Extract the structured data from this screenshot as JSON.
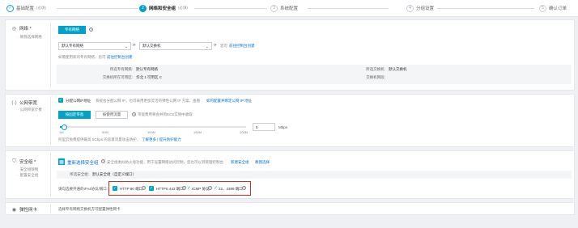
{
  "steps": [
    {
      "num": "✓",
      "label": "基础配置",
      "sub": "(必填)",
      "state": "done"
    },
    {
      "num": "2",
      "label": "网络和安全组",
      "sub": "(必填)",
      "state": "active"
    },
    {
      "num": "3",
      "label": "系统配置",
      "sub": "",
      "state": "todo"
    },
    {
      "num": "4",
      "label": "分组设置",
      "sub": "",
      "state": "todo"
    },
    {
      "num": "5",
      "label": "确认订单",
      "sub": "",
      "state": "todo"
    }
  ],
  "network": {
    "title": "网络 *",
    "subtitle": "· 教我选择网络",
    "tab_label": "专有网络",
    "vpc_select": "默认专有网络",
    "vswitch_select": "默认交换机",
    "refresh_hint": "您可",
    "vswitch_link": "前往控制台创建",
    "note_text": "如需使用新的专有网络，您可",
    "note_link": "前往控制台创建",
    "info": [
      {
        "key": "所选专有网络:",
        "val": "默认专有网络"
      },
      {
        "key": "交换机所在可用区:",
        "val": "华北 1 可用区 C"
      },
      {
        "key": "所选交换机:",
        "val": "默认交换机"
      },
      {
        "key": "交换机网段:",
        "val": ""
      }
    ]
  },
  "public_ip": {
    "title": "公网带宽",
    "subtitle": "· 公网带宽计费",
    "checkbox_label": "分配公网IP地址",
    "checkbox_hint": "系统会分配公网 IP，也可采用更加灵活的弹性公网 IP 方案，查看",
    "checkbox_link": "如何配置并绑定公网 IP 地址",
    "billing_options": [
      "按固定带宽",
      "按使用流量"
    ],
    "billing_hint": "带宽费用将会并到ECS实例中收取",
    "ticks": [
      "1M",
      "50M",
      "100M",
      "150M",
      "200M"
    ],
    "bandwidth_value": "5",
    "bandwidth_fraction": 0.02,
    "unit": "Mbps",
    "footnote": "阿里云免费提供最高 5Gbps 的恶意流量攻击防护，",
    "footnote_link": "了解更多 | 提升防护能力"
  },
  "security": {
    "title": "安全组 *",
    "subtitle1": "· 安全组限制",
    "subtitle2": "· 配置安全组",
    "reselect_label": "重新选择安全组",
    "reselect_hint": "安全组类似防火墙功能，用于设置网络访问控制，您也可以到管理控制台",
    "reselect_link": "新建安全组",
    "reselect_link2": "教我选择",
    "selected_key": "所选安全组:",
    "selected_val": "默认安全组（自定义端口）",
    "ports_label": "请勾选要开通的IPv4协议/端口:",
    "ports": [
      {
        "label": "HTTP 80 端口",
        "checked": true
      },
      {
        "label": "HTTPS 443 端口",
        "checked": true
      },
      {
        "label": "ICMP 协议",
        "checked": true
      },
      {
        "label": "22、3389 端口",
        "checked": true
      }
    ]
  },
  "eni": {
    "title": "弹性网卡",
    "hint": "选择专有网络交换机方可配置弹性网卡"
  }
}
